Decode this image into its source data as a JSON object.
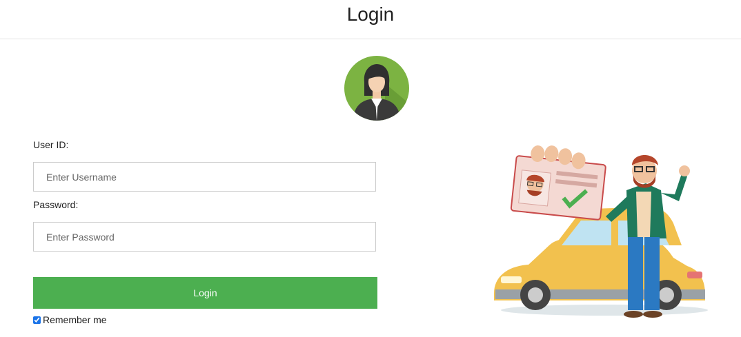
{
  "header": {
    "title": "Login"
  },
  "form": {
    "user_id_label": "User ID:",
    "username_placeholder": "Enter Username",
    "username_value": "",
    "password_label": "Password:",
    "password_placeholder": "Enter Password",
    "password_value": "",
    "login_label": "Login",
    "remember_label": "Remember me",
    "remember_checked": true
  },
  "colors": {
    "accent": "#4caf50",
    "avatar_bg": "#7cb342"
  },
  "icons": {
    "avatar": "user-avatar-icon",
    "illustration": "driver-license-car-illustration"
  }
}
